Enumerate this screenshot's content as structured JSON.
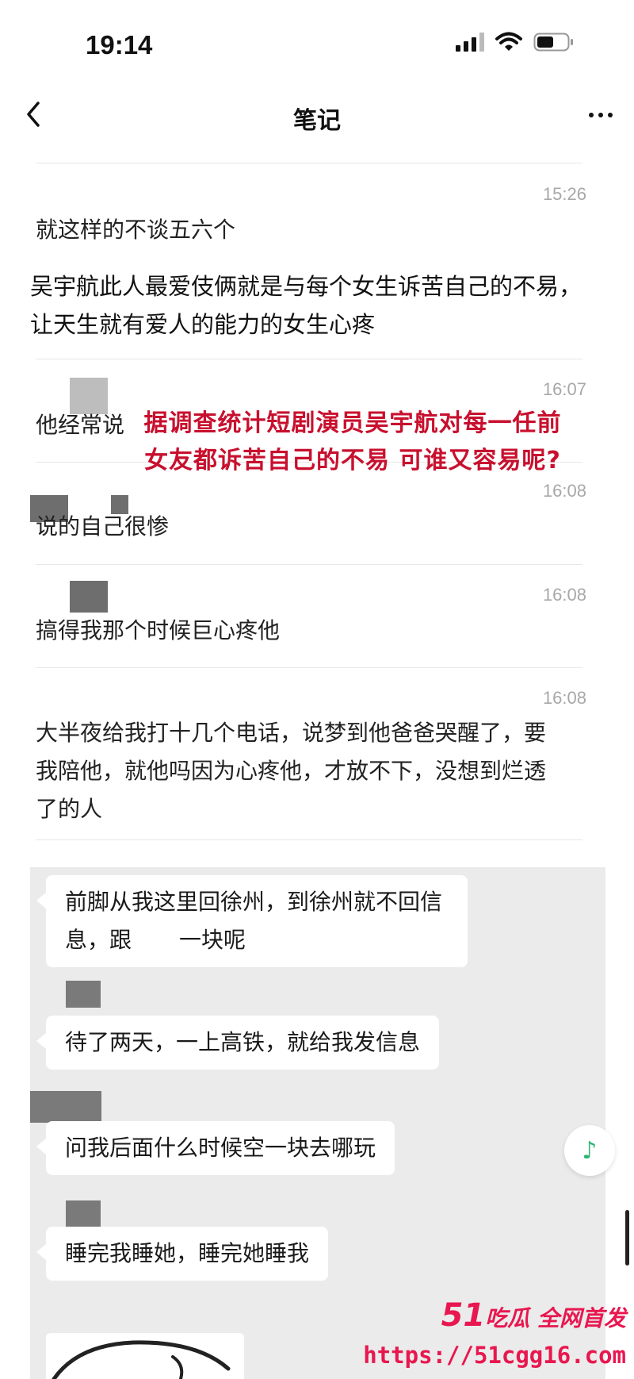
{
  "status_bar": {
    "time": "19:14",
    "icons": [
      "signal-icon",
      "wifi-icon",
      "battery-icon"
    ]
  },
  "nav": {
    "title": "笔记",
    "back_icon": "chevron-left-icon",
    "more_icon": "more-horizontal-icon"
  },
  "notes": [
    {
      "time": "15:26",
      "text": "就这样的不谈五六个"
    },
    {
      "text": "吴宇航此人最爱伎俩就是与每个女生诉苦自己的不易，让天生就有爱人的能力的女生心疼"
    },
    {
      "time": "16:07",
      "text": "他经常说"
    },
    {
      "time": "16:08",
      "text": "说的自己很惨"
    },
    {
      "time": "16:08",
      "text": "搞得我那个时候巨心疼他"
    },
    {
      "time": "16:08",
      "text": "大半夜给我打十几个电话，说梦到他爸爸哭醒了，要我陪他，就他吗因为心疼他，才放不下，没想到烂透了的人"
    }
  ],
  "overlay_caption": "据调查统计短剧演员吴宇航对每一任前女友都诉苦自己的不易 可谁又容易呢?",
  "chat": [
    {
      "text": "前脚从我这里回徐州，到徐州就不回信息，跟",
      "text2": "一块呢"
    },
    {
      "text": "待了两天，一上高铁，就给我发信息"
    },
    {
      "text": "问我后面什么时候空一块去哪玩"
    },
    {
      "text": "睡完我睡她，睡完她睡我"
    }
  ],
  "music_icon": "music-note-icon",
  "watermark": {
    "brand_num": "51",
    "brand_text": "吃瓜 全网首发",
    "url": "https://51cgg16.com"
  },
  "colors": {
    "caption_red": "#c8102e",
    "watermark_pink": "#e8174f",
    "timestamp_gray": "#a8a8a8",
    "music_green": "#2bb673"
  }
}
